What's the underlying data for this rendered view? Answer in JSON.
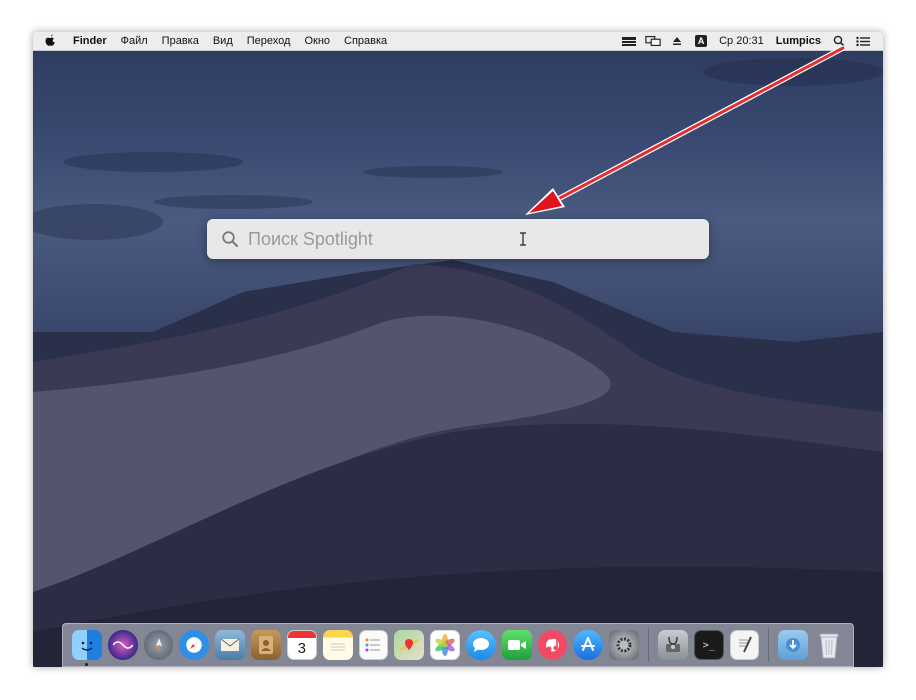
{
  "menubar": {
    "apple_glyph": "",
    "app_name": "Finder",
    "items": [
      "Файл",
      "Правка",
      "Вид",
      "Переход",
      "Окно",
      "Справка"
    ],
    "input_badge": "A",
    "clock": "Ср 20:31",
    "user": "Lumpics"
  },
  "spotlight": {
    "placeholder": "Поиск Spotlight",
    "value": ""
  },
  "dock": {
    "items": [
      {
        "name": "finder",
        "glyph": "☺",
        "color": "#2a8ef0"
      },
      {
        "name": "siri",
        "glyph": "◉",
        "color": "#7a3cc8"
      },
      {
        "name": "launchpad",
        "glyph": "🚀",
        "color": "#6f7680"
      },
      {
        "name": "safari",
        "glyph": "✦",
        "color": "#2f8fe6"
      },
      {
        "name": "mail",
        "glyph": "✉",
        "color": "#5a8fbf"
      },
      {
        "name": "contacts",
        "glyph": "☻",
        "color": "#b88a4a"
      },
      {
        "name": "calendar",
        "glyph": "3",
        "color": "#ffffff"
      },
      {
        "name": "notes",
        "glyph": "≡",
        "color": "#f6df6a"
      },
      {
        "name": "reminders",
        "glyph": "☰",
        "color": "#f4f4f4"
      },
      {
        "name": "maps",
        "glyph": "◈",
        "color": "#6bbf6a"
      },
      {
        "name": "photos",
        "glyph": "✿",
        "color": "#f0f0f0"
      },
      {
        "name": "messages",
        "glyph": "✉",
        "color": "#3fa3ee"
      },
      {
        "name": "facetime",
        "glyph": "▶",
        "color": "#3cc24f"
      },
      {
        "name": "music",
        "glyph": "♫",
        "color": "#f24a64"
      },
      {
        "name": "app-store",
        "glyph": "A",
        "color": "#2f8ff0"
      },
      {
        "name": "system-preferences",
        "glyph": "⚙",
        "color": "#8a8e95"
      },
      {
        "name": "disk-utility",
        "glyph": "⚕",
        "color": "#9aa0a8"
      },
      {
        "name": "terminal",
        "glyph": ">_",
        "color": "#1e1e1e"
      },
      {
        "name": "textedit",
        "glyph": "✎",
        "color": "#f2f2f2"
      },
      {
        "name": "downloads",
        "glyph": "⬇",
        "color": "#7cb6e6"
      },
      {
        "name": "trash",
        "glyph": "🗑",
        "color": "#d9dde2"
      }
    ]
  },
  "colors": {
    "annotation_arrow": "#e0151b",
    "menubar_bg": "#f5f5f5"
  }
}
